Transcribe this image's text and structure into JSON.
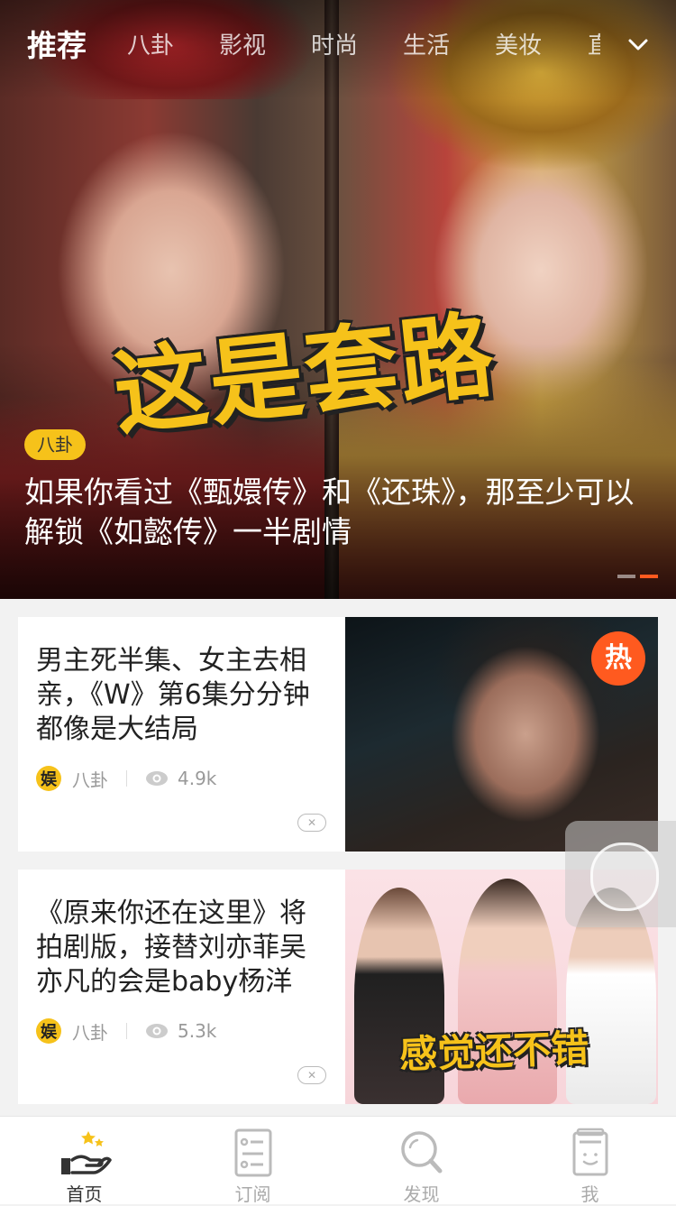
{
  "top_tabs": [
    "推荐",
    "八卦",
    "影视",
    "时尚",
    "生活",
    "美妆",
    "直"
  ],
  "hero": {
    "overlay_text": "这是套路",
    "badge": "八卦",
    "headline": "如果你看过《甄嬛传》和《还珠》，那至少可以解锁《如懿传》一半剧情",
    "pager": {
      "count": 2,
      "active_index": 1
    }
  },
  "feed": [
    {
      "title": "男主死半集、女主去相亲，《W》第6集分分钟都像是大结局",
      "source_icon": "娱",
      "category": "八卦",
      "views": "4.9k",
      "thumb_badge": "热"
    },
    {
      "title": "《原来你还在这里》将拍剧版，接替刘亦菲吴亦凡的会是baby杨洋",
      "source_icon": "娱",
      "category": "八卦",
      "views": "5.3k",
      "thumb_text": "感觉还不错"
    }
  ],
  "tabbar": [
    {
      "label": "首页",
      "icon": "home-hand-stars-icon",
      "active": true
    },
    {
      "label": "订阅",
      "icon": "list-document-icon",
      "active": false
    },
    {
      "label": "发现",
      "icon": "search-icon",
      "active": false
    },
    {
      "label": "我",
      "icon": "profile-card-icon",
      "active": false
    }
  ],
  "colors": {
    "accent": "#ff5a1f",
    "badge_yellow": "#f6c21a",
    "text_dark": "#222222",
    "text_muted": "#999999"
  }
}
